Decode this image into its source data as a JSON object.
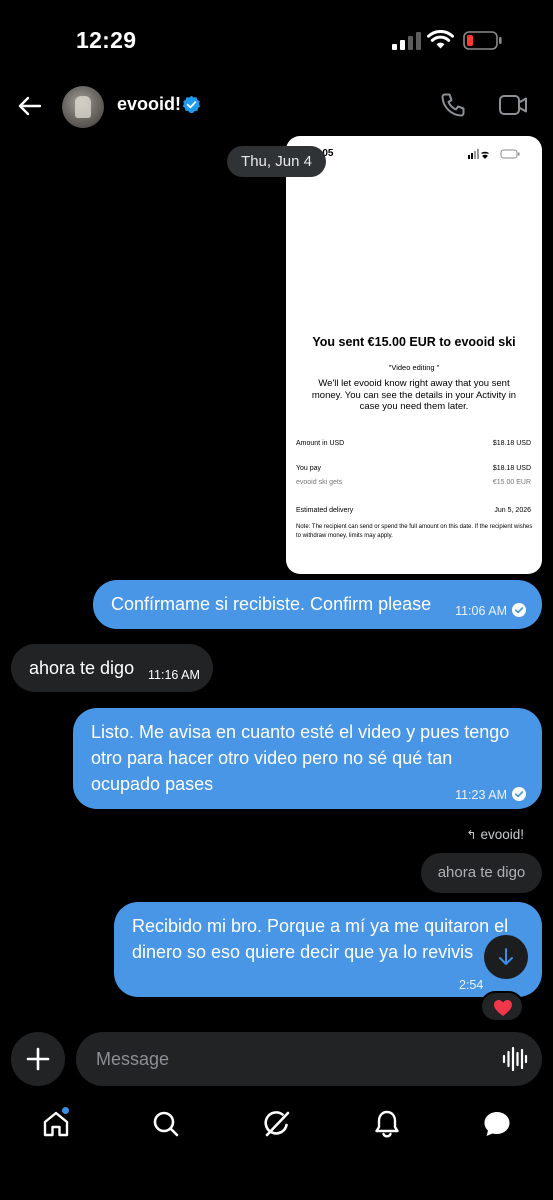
{
  "status_bar": {
    "time": "12:29"
  },
  "header": {
    "username": "evooid!"
  },
  "chat": {
    "date_separator": "Thu, Jun 4",
    "screenshot": {
      "time": ":05",
      "title": "You sent €15.00 EUR to evooid ski",
      "note": "\"Video editing \"",
      "body": "We'll let evooid know right away that you sent money. You can see the details in your Activity in case you need them later.",
      "rows": [
        {
          "label": "Amount in USD",
          "value": "$18.18 USD"
        },
        {
          "label": "You pay",
          "value": "$18.18 USD"
        },
        {
          "label": "evooid ski gets",
          "value": "€15.00 EUR"
        },
        {
          "label": "Estimated delivery",
          "value": "Jun 5, 2026"
        }
      ],
      "fine_print": "Note: The recipient can send or spend the full amount on this date. If the recipient wishes to withdraw money, limits may apply."
    },
    "messages": [
      {
        "text": "Confírmame si recibiste. Confirm please",
        "time": "11:06 AM"
      },
      {
        "text": "ahora te digo",
        "time": "11:16 AM"
      },
      {
        "text": "Listo. Me avisa en cuanto esté el video y pues tengo otro para hacer otro video pero no sé qué tan ocupado pases",
        "time": "11:23 AM"
      },
      {
        "text": "Recibido mi bro. Porque a mí ya me quitaron el dinero so eso quiere decir que ya lo revivis",
        "time": "2:54"
      }
    ],
    "reply": {
      "label": "evooid!",
      "quoted_text": "ahora te digo"
    }
  },
  "composer": {
    "placeholder": "Message"
  },
  "colors": {
    "outgoing_bubble": "#4a96e6",
    "incoming_bubble": "#222325",
    "background": "#000000"
  },
  "icons": {
    "header": [
      "back-arrow-icon",
      "verified-badge-icon",
      "phone-icon",
      "video-camera-icon"
    ],
    "composer": [
      "plus-icon",
      "voice-wave-icon"
    ],
    "tabs": [
      "home-icon",
      "search-icon",
      "grok-icon",
      "notifications-bell-icon",
      "messages-icon"
    ]
  }
}
